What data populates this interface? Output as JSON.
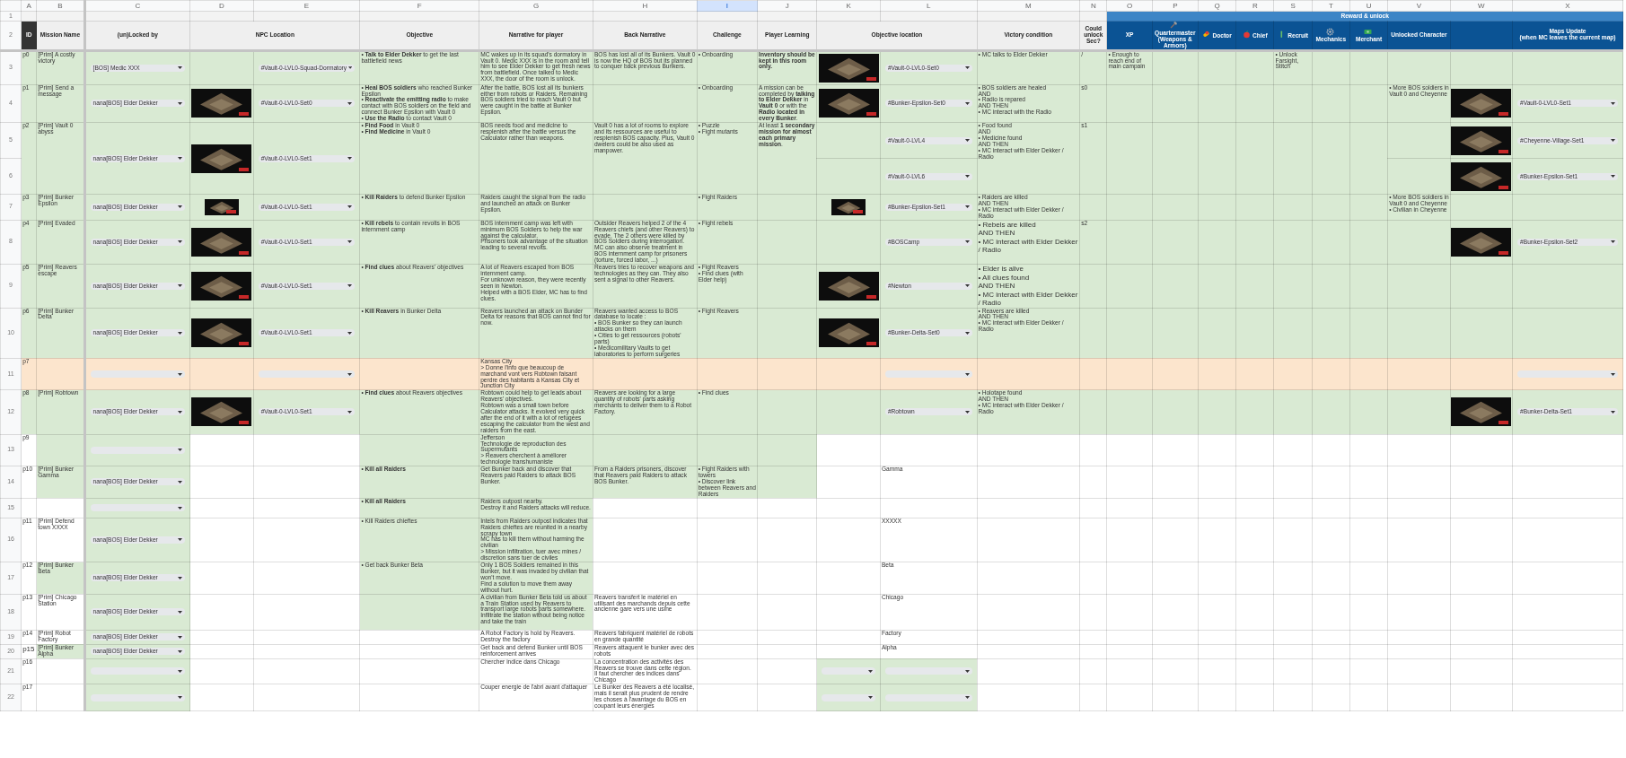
{
  "sheet": {
    "column_letters": [
      {
        "letter": "A",
        "selected": false
      },
      {
        "letter": "B",
        "selected": false
      },
      {
        "letter": "C",
        "selected": false
      },
      {
        "letter": "D",
        "selected": false
      },
      {
        "letter": "E",
        "selected": false
      },
      {
        "letter": "F",
        "selected": false
      },
      {
        "letter": "G",
        "selected": false
      },
      {
        "letter": "H",
        "selected": false
      },
      {
        "letter": "I",
        "selected": true
      },
      {
        "letter": "J",
        "selected": false
      },
      {
        "letter": "K",
        "selected": false
      },
      {
        "letter": "L",
        "selected": false
      },
      {
        "letter": "M",
        "selected": false
      },
      {
        "letter": "N",
        "selected": false
      },
      {
        "letter": "O",
        "selected": false
      },
      {
        "letter": "P",
        "selected": false
      },
      {
        "letter": "Q",
        "selected": false
      },
      {
        "letter": "R",
        "selected": false
      },
      {
        "letter": "S",
        "selected": false
      },
      {
        "letter": "T",
        "selected": false
      },
      {
        "letter": "U",
        "selected": false
      },
      {
        "letter": "V",
        "selected": false
      },
      {
        "letter": "W",
        "selected": false
      },
      {
        "letter": "X",
        "selected": false
      }
    ],
    "header_row_numbers": [
      "1",
      "2"
    ],
    "group_header": {
      "label": "Reward & unlock"
    },
    "headers": [
      {
        "label": "ID",
        "kind": "id"
      },
      {
        "label": "Mission Name",
        "kind": "plain"
      },
      {
        "label": "(un)Locked by",
        "kind": "plain"
      },
      {
        "label": "NPC Location",
        "kind": "plain",
        "wide": true
      },
      {
        "label": "Objective",
        "kind": "plain"
      },
      {
        "label": "Narrative for player",
        "kind": "plain"
      },
      {
        "label": "Back Narrative",
        "kind": "plain"
      },
      {
        "label": "Challenge",
        "kind": "plain"
      },
      {
        "label": "Player Learning",
        "kind": "plain"
      },
      {
        "label": "Objective location",
        "kind": "plain",
        "wide": true
      },
      {
        "label": "Victory condition",
        "kind": "plain"
      },
      {
        "label": "Could unlock Sec?",
        "kind": "plain"
      },
      {
        "label": "XP",
        "kind": "reward",
        "grouped": true
      },
      {
        "label": "Quartermaster (Weapons & Armors)",
        "kind": "role",
        "grouped": true
      },
      {
        "label": "Doctor",
        "kind": "role",
        "grouped": true
      },
      {
        "label": "Chief",
        "kind": "role",
        "grouped": true
      },
      {
        "label": "Recruit",
        "kind": "role",
        "grouped": true
      },
      {
        "label": "Mechanics",
        "kind": "role",
        "grouped": true
      },
      {
        "label": "Merchant",
        "kind": "role",
        "grouped": true
      },
      {
        "label": "Unlocked Character",
        "kind": "reward",
        "grouped": true
      },
      {
        "kind": "reward",
        "grouped": true
      },
      {
        "label": "Maps Update\n(when MC leaves the current map)",
        "kind": "reward",
        "grouped": true
      }
    ],
    "rows": [
      {
        "number": "3",
        "color": "#d9ead3",
        "cells": [
          {
            "text": "p0"
          },
          {
            "text": "[Prim] A costly victory"
          },
          {
            "kind": "dropdown",
            "value": "[BOS] Medic XXX"
          },
          {},
          {
            "kind": "dropdown",
            "value": "#Vault-0-LVL0-Squad-Dormatory"
          },
          {
            "text": "• **Talk to Elder Dekker** to get the last battlefield news"
          },
          {
            "text": "MC wakes up in its squad's dormatory in Vault 0. Medic XXX is in the room and tell him to see Elder Dekker to get fresh news from battlefield. Once talked to Medic XXX, the door of the room is unlock."
          },
          {
            "text": "BOS has lost all of its Bunkers. Vault 0 is now the HQ of BOS but its planned to conquer back previous Bunkers."
          },
          {
            "text": "• Onboarding"
          },
          {
            "text": "Inventory should be kept in this room only.",
            "bold": true
          },
          {
            "kind": "image"
          },
          {
            "kind": "dropdown",
            "value": "#Vault-0-LVL0-Set0"
          },
          {
            "text": "• MC talks to Elder Dekker"
          },
          {
            "text": "/"
          },
          {
            "text": "• Enough to reach end of main campain"
          },
          {},
          {},
          {},
          {
            "text": "• Unlock Farsight, Stitch"
          }
        ]
      },
      {
        "number": "4",
        "color": "#d9ead3",
        "cells": [
          {
            "text": "p1"
          },
          {
            "text": "[Prim] Send a message"
          },
          {
            "kind": "dropdown",
            "value": "nana[BOS] Elder Dekker"
          },
          {
            "kind": "image"
          },
          {
            "kind": "dropdown",
            "value": "#Vault-0-LVL0-Set0"
          },
          {
            "text": "• **Heal BOS soldiers** who reached Bunker Epsilon\n• **Reactivate the emitting radio** to make contact with BOS soldiers on the field and connect Bunker Epsilon with Vault 0\n• **Use the Radio** to contact Vault 0"
          },
          {
            "text": "After the battle, BOS lost all its bunkers either from robots or Raiders. Remaining BOS soldiers tried to reach Vault 0 but were caught in the battle at Bunker Epsilon."
          },
          {},
          {
            "text": "• Onboarding"
          },
          {
            "text": "A mission can be completed by **talking to Elder Dekker** in **Vault 0** or with the **Radio located in every Bunker**."
          },
          {
            "kind": "image"
          },
          {
            "kind": "dropdown",
            "value": "#Bunker-Epsilon-Set0"
          },
          {
            "text": "• BOS soldiers are healed\nAND\n• Radio is repared\nAND THEN\n• MC interact with the Radio"
          },
          {
            "text": "s0"
          },
          {},
          {},
          {},
          {},
          {},
          {},
          {},
          {
            "text": "• More BOS soldiers in Vault 0 and Cheyenne"
          },
          {
            "kind": "image"
          },
          {
            "kind": "dropdown",
            "value": "#Vault-0-LVL0-Set1"
          }
        ]
      },
      {
        "number": "5",
        "color": "#d9ead3",
        "cells": [
          {
            "text": "p2",
            "rowspan": 2
          },
          {
            "text": "[Prim] Vault 0 abyss",
            "rowspan": 2
          },
          {
            "kind": "dropdown",
            "value": "nana[BOS] Elder Dekker",
            "rowspan": 2
          },
          {
            "kind": "image",
            "rowspan": 2
          },
          {
            "kind": "dropdown",
            "value": "#Vault-0-LVL0-Set1",
            "rowspan": 2
          },
          {
            "text": "• **Find Food** in Vault 0\n• **Find Medicine** in Vault 0",
            "rowspan": 2
          },
          {
            "text": "BOS needs food and medicine to resplenish after the battle versus the Calculator rather than weapons.",
            "rowspan": 2
          },
          {
            "text": "Vault 0 has a lot of rooms to explore and its ressources are useful to resplenish BOS capacity. Plus, Vault 0 dwelers could be also used as manpower.",
            "rowspan": 2
          },
          {
            "text": "• Puzzle\n• Fight mutants",
            "rowspan": 2
          },
          {
            "text": "At least **1 secondary mission for almost each primary mission**.",
            "rowspan": 2
          },
          {},
          {
            "kind": "dropdown",
            "value": "#Vault-0-LVL4"
          },
          {
            "text": "• Food found\nAND\n• Medicine found\nAND THEN\n• MC interact with Elder Dekker / Radio",
            "rowspan": 2
          },
          {
            "text": "s1",
            "rowspan": 2
          },
          {
            "rowspan": 2
          },
          {
            "rowspan": 2
          },
          {
            "rowspan": 2
          },
          {
            "rowspan": 2
          },
          {
            "rowspan": 2
          },
          {
            "rowspan": 2
          },
          {
            "rowspan": 2
          },
          {},
          {
            "kind": "image"
          },
          {
            "kind": "dropdown",
            "value": "#Cheyenne-Village-Set1"
          }
        ]
      },
      {
        "number": "6",
        "color": "#d9ead3",
        "cells": [
          {},
          {
            "kind": "dropdown",
            "value": "#Vault-0-LVL6"
          },
          {},
          {
            "kind": "image"
          },
          {
            "kind": "dropdown",
            "value": "#Bunker-Epsilon-Set1"
          }
        ]
      },
      {
        "number": "7",
        "color": "#d9ead3",
        "cells": [
          {
            "text": "p3"
          },
          {
            "text": "[Prim] Bunker Epsilon"
          },
          {
            "kind": "dropdown",
            "value": "nana[BOS] Elder Dekker"
          },
          {
            "kind": "image"
          },
          {
            "kind": "dropdown",
            "value": "#Vault-0-LVL0-Set1"
          },
          {
            "text": "• **Kill Raiders** to defend Bunker Epsilon"
          },
          {
            "text": "Raiders caught the signal from the radio and launched an attack on Bunker Epsilon."
          },
          {},
          {
            "text": "• Fight Raiders"
          },
          {},
          {
            "kind": "image"
          },
          {
            "kind": "dropdown",
            "value": "#Bunker-Epsilon-Set1"
          },
          {
            "text": "• Raiders are killed\nAND THEN\n• MC interact with Elder Dekker / Radio"
          },
          {},
          {},
          {},
          {},
          {},
          {},
          {},
          {},
          {
            "text": "• More BOS soldiers in Vault 0 and Cheyenne\n• Civilian in Cheyenne"
          }
        ]
      },
      {
        "number": "8",
        "color": "#d9ead3",
        "cells": [
          {
            "text": "p4"
          },
          {
            "text": "[Prim] Evaded"
          },
          {
            "kind": "dropdown",
            "value": "nana[BOS] Elder Dekker"
          },
          {
            "kind": "image"
          },
          {
            "kind": "dropdown",
            "value": "#Vault-0-LVL0-Set1"
          },
          {
            "text": "• **Kill rebels** to contain revolts in BOS internment camp"
          },
          {
            "text": "BOS internment camp was left with minimum BOS Soldiers to help the war against the calculator.\nPrisoners took advantage of the situation leading to several revolts."
          },
          {
            "text": "Outsider Reavers helped 2 of the 4 Reavers chiefs (and other Reavers) to evade. The 2 others were killed by BOS Soldiers during interrogation.\nMC can also observe treatment in BOS internment camp for prisoners (torture, forced labor, ...)"
          },
          {
            "text": "• Fight rebels"
          },
          {},
          {},
          {
            "kind": "dropdown",
            "value": "#BOSCamp"
          },
          {
            "text": "• Rebels are killed\nAND THEN\n• MC interact with Elder Dekker / Radio",
            "large": true
          },
          {
            "text": "s2"
          },
          {},
          {},
          {},
          {},
          {},
          {},
          {},
          {},
          {
            "kind": "image"
          },
          {
            "kind": "dropdown",
            "value": "#Bunker-Epsilon-Set2"
          }
        ]
      },
      {
        "number": "9",
        "color": "#d9ead3",
        "cells": [
          {
            "text": "p5"
          },
          {
            "text": "[Prim] Reavers escape"
          },
          {
            "kind": "dropdown",
            "value": "nana[BOS] Elder Dekker"
          },
          {
            "kind": "image"
          },
          {
            "kind": "dropdown",
            "value": "#Vault-0-LVL0-Set1"
          },
          {
            "text": "• **Find clues** about Reavers' objectives"
          },
          {
            "text": "A lot of Reavers escaped from BOS internment camp.\nFor unknown reason, they were recently seen in Newton.\nHelped with a BOS Elder, MC has to find clues."
          },
          {
            "text": "Reavers tries to recover weapons and technologies as they can. They also sent a signal to other Reavers."
          },
          {
            "text": "• Fight Reavers\n• Find clues (with Elder help)"
          },
          {},
          {
            "kind": "image"
          },
          {
            "kind": "dropdown",
            "value": "#Newton"
          },
          {
            "text": "• Elder is alive\n• All clues found\nAND THEN\n• MC interact with Elder Dekker / Radio",
            "large": true
          }
        ]
      },
      {
        "number": "10",
        "color": "#d9ead3",
        "cells": [
          {
            "text": "p6"
          },
          {
            "text": "[Prim] Bunker Delta"
          },
          {
            "kind": "dropdown",
            "value": "nana[BOS] Elder Dekker"
          },
          {
            "kind": "image"
          },
          {
            "kind": "dropdown",
            "value": "#Vault-0-LVL0-Set1"
          },
          {
            "text": "• **Kill Reavers** in Bunker Delta"
          },
          {
            "text": "Reavers launched an attack on Bunder Delta for reasons that BOS cannot find for now."
          },
          {
            "text": "Reavers wanted access to BOS database to locate :\n• BOS Bunker so they can launch attacks on them\n• Cities to get ressources (robots' parts)\n• Medicomilitary Vaults to get laboratories to perform surgeries"
          },
          {
            "text": "• Fight Reavers"
          },
          {},
          {
            "kind": "image"
          },
          {
            "kind": "dropdown",
            "value": "#Bunker-Delta-Set0"
          },
          {
            "text": "• Reavers are killed\nAND THEN\n• MC interact with Elder Dekker / Radio"
          }
        ]
      },
      {
        "number": "11",
        "color": "#fce5cd",
        "cells": [
          {
            "text": "p7"
          },
          {},
          {
            "kind": "dropdown"
          },
          {},
          {
            "kind": "dropdown"
          },
          {},
          {
            "text": "Kansas City\n> Donne l'info que beaucoup de marchand vont vers Robtown faisant perdre des habitants à Kansas City et Junction City"
          },
          {},
          {},
          {},
          {},
          {
            "kind": "dropdown"
          },
          {},
          {},
          {},
          {},
          {},
          {},
          {},
          {},
          {},
          {},
          {},
          {
            "kind": "dropdown"
          }
        ]
      },
      {
        "number": "12",
        "color": "#d9ead3",
        "cells": [
          {
            "text": "p8"
          },
          {
            "text": "[Prim] Robtown"
          },
          {
            "kind": "dropdown",
            "value": "nana[BOS] Elder Dekker"
          },
          {
            "kind": "image"
          },
          {
            "kind": "dropdown",
            "value": "#Vault-0-LVL0-Set1"
          },
          {
            "text": "• **Find clues** about Reavers objectives"
          },
          {
            "text": "Robtown could help to get leads about Reavers' objectives.\nRobtown was a small town before Calculator attacks. It evolved very quick after the end of it with a lot of refugees escaping the calculator from the west and raiders from the east."
          },
          {
            "text": "Reavers are looking for a large quantity of robots' parts asking merchants to deliver them to a Robot Factory."
          },
          {
            "text": "• Find clues"
          },
          {},
          {},
          {
            "kind": "dropdown",
            "value": "#Robtown"
          },
          {
            "text": "• Holotape found\nAND THEN\n• MC interact with Elder Dekker / Radio"
          },
          {},
          {},
          {},
          {},
          {},
          {},
          {},
          {},
          {},
          {
            "kind": "image"
          },
          {
            "kind": "dropdown",
            "value": "#Bunker-Delta-Set1"
          }
        ]
      },
      {
        "number": "13",
        "cells": [
          {
            "text": "p9"
          },
          {
            "color": "#d9ead3"
          },
          {
            "kind": "dropdown",
            "color": "#d9ead3"
          },
          {},
          {},
          {
            "color": "#d9ead3"
          },
          {
            "text": "Jefferson\nTechnologie de reproduction des Supermutants\n> Reavers cherchent à améliorer technologie transhumaniste",
            "color": "#d9ead3"
          },
          {
            "color": "#d9ead3"
          },
          {
            "color": "#d9ead3"
          },
          {
            "color": "#d9ead3"
          }
        ]
      },
      {
        "number": "14",
        "cells": [
          {
            "text": "p10"
          },
          {
            "text": "[Prim] Bunker Gamma",
            "color": "#d9ead3"
          },
          {
            "kind": "dropdown",
            "value": "nana[BOS] Elder Dekker",
            "color": "#d9ead3"
          },
          {},
          {},
          {
            "text": "• Kill all Raiders",
            "bold": true,
            "color": "#d9ead3"
          },
          {
            "text": "Get Bunker back and discover that Reavers paid Raiders to attack BOS Bunker.",
            "color": "#d9ead3"
          },
          {
            "text": "From a Raiders prisoners, discover that Reavers paid Raiders to attack BOS Bunker.",
            "color": "#d9ead3"
          },
          {
            "text": "• Fight Raiders with towers\n• Discover link between Reavers and Raiders",
            "color": "#d9ead3"
          },
          {
            "color": "#d9ead3"
          },
          {},
          {
            "text": "Gamma"
          }
        ]
      },
      {
        "number": "15",
        "cells": [
          {},
          {},
          {
            "kind": "dropdown",
            "color": "#d9ead3"
          },
          {},
          {},
          {
            "text": "• Kill all Raiders",
            "bold": true,
            "color": "#d9ead3"
          },
          {
            "text": "Raiders outpost nearby.\nDestroy it and Raiders attacks will reduce.",
            "color": "#d9ead3"
          }
        ]
      },
      {
        "number": "16",
        "cells": [
          {
            "text": "p11"
          },
          {
            "text": "[Prim] Defend town XXXX"
          },
          {
            "kind": "dropdown",
            "value": "nana[BOS] Elder Dekker",
            "color": "#d9ead3"
          },
          {},
          {},
          {
            "text": "• Kill Raiders chieftes",
            "color": "#d9ead3"
          },
          {
            "text": "Intels from Raiders outpost indicates that Raiders chieftes are reunited in a nearby scrapy town\nMC has to kill them without harming the civilian\n> Mission infiltration, tuer avec mines / discretion sans tuer de civiles",
            "color": "#d9ead3"
          },
          {},
          {},
          {},
          {},
          {
            "text": "XXXXX"
          }
        ]
      },
      {
        "number": "17",
        "cells": [
          {
            "text": "p12"
          },
          {
            "text": "[Prim] Bunker Beta",
            "color": "#d9ead3"
          },
          {
            "kind": "dropdown",
            "value": "nana[BOS] Elder Dekker",
            "color": "#d9ead3"
          },
          {},
          {},
          {
            "text": "• Get back Bunker Beta",
            "color": "#d9ead3"
          },
          {
            "text": "Only 1 BOS Soldiers remained in this Bunker, but it was invaded by civilian that won't move.\nFind a solution to move them away without hurt.",
            "color": "#d9ead3"
          },
          {},
          {},
          {},
          {},
          {
            "text": "Beta"
          }
        ]
      },
      {
        "number": "18",
        "cells": [
          {
            "text": "p13"
          },
          {
            "text": "[Prim] Chicago Station"
          },
          {
            "kind": "dropdown",
            "value": "nana[BOS] Elder Dekker",
            "color": "#d9ead3"
          },
          {},
          {},
          {
            "color": "#d9ead3"
          },
          {
            "text": "A civilian from Bunker Beta told us about a Train Station used by Reavers to transport large robots parts somewhere.\nInfiltrate the station without being notice and take the train",
            "color": "#d9ead3"
          },
          {
            "text": "Reavers transfert le matériel en utilisant des marchands depuis cette ancienne gare vers une usine"
          },
          {},
          {},
          {},
          {
            "text": "Chicago"
          }
        ]
      },
      {
        "number": "19",
        "cells": [
          {
            "text": "p14"
          },
          {
            "text": "[Prim] Robot Factory"
          },
          {
            "kind": "dropdown",
            "value": "nana[BOS] Elder Dekker",
            "color": "#d9ead3"
          },
          {},
          {},
          {},
          {
            "text": "A Robot Factory is hold by Reavers.\nDestroy the factory"
          },
          {
            "text": "Reavers fabriquent matériel de robots en grande quantité"
          },
          {},
          {},
          {},
          {
            "text": "Factory"
          }
        ]
      },
      {
        "number": "20",
        "cells": [
          {
            "text": "p15",
            "large": true
          },
          {
            "text": "[Prim] Bunker Alpha",
            "color": "#d9ead3"
          },
          {
            "kind": "dropdown",
            "value": "nana[BOS] Elder Dekker",
            "color": "#d9ead3"
          },
          {},
          {},
          {},
          {
            "text": "Get back and defend Bunker until BOS reinforcement arrives"
          },
          {
            "text": "Reavers attaquent le bunker avec des robots"
          },
          {},
          {},
          {},
          {
            "text": "Alpha"
          }
        ]
      },
      {
        "number": "21",
        "cells": [
          {
            "text": "p16"
          },
          {},
          {
            "kind": "dropdown",
            "color": "#d9ead3"
          },
          {},
          {},
          {},
          {
            "text": "Chercher indice dans Chicago"
          },
          {
            "text": "La concentration des activités des Reavers se trouve dans cette région. Il faut chercher des indices dans Chicago"
          },
          {},
          {},
          {
            "kind": "dropdown",
            "color": "#d9ead3"
          },
          {
            "kind": "dropdown",
            "color": "#d9ead3"
          }
        ]
      },
      {
        "number": "22",
        "cells": [
          {
            "text": "p17"
          },
          {},
          {
            "kind": "dropdown",
            "color": "#d9ead3"
          },
          {},
          {},
          {},
          {
            "text": "Couper energie de l'abri avant d'attaquer"
          },
          {
            "text": "Le Bunker des Reavers a été localisé, mais il serait plus prudent de rendre les choses à l'avantage du BOS en coupant leurs énergies"
          },
          {},
          {},
          {
            "kind": "dropdown",
            "color": "#d9ead3"
          },
          {
            "kind": "dropdown",
            "color": "#d9ead3"
          }
        ]
      }
    ]
  }
}
